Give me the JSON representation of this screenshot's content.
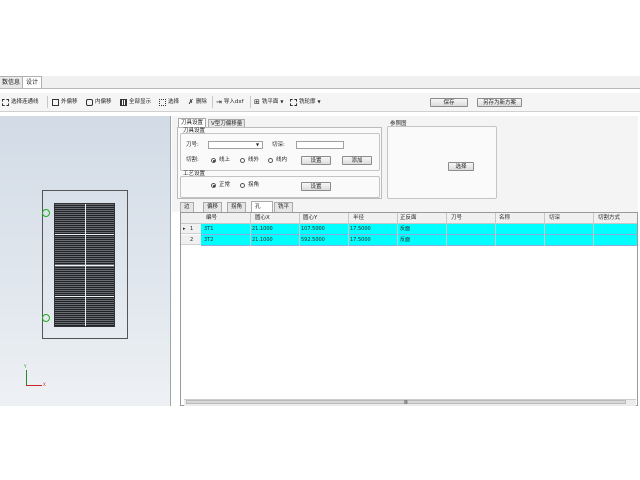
{
  "tabs": [
    {
      "label": "数信息"
    },
    {
      "label": "设计"
    }
  ],
  "toolbar": {
    "select_chain": "选择连通线",
    "outer_offset": "外偏移",
    "inner_offset": "内偏移",
    "show_all": "全部显示",
    "select": "选择",
    "delete": "删除",
    "import_dxf": "导入dxf",
    "mill_plane": "铣平面",
    "mill_contour": "铣轮廓",
    "save": "保存",
    "save_as_new": "另存为新方案"
  },
  "tool_panel": {
    "tabs": [
      "刀具设置",
      "V型刀偏移量"
    ],
    "tool_group_title": "刀具设置",
    "tool_no_label": "刀号:",
    "tool_no_value": "",
    "cut_depth_label": "切深:",
    "cut_depth_value": "",
    "cut_label": "切割:",
    "cut_options": [
      "线上",
      "线外",
      "线内"
    ],
    "cut_selected": 0,
    "setup_button": "设置",
    "add_button": "添加",
    "process_group_title": "工艺设置",
    "process_options": [
      "正常",
      "拐角"
    ],
    "process_selected": 0,
    "process_setup_button": "设置"
  },
  "reference": {
    "title": "参照图",
    "select_button": "选择"
  },
  "grid": {
    "tabs": [
      "边",
      "偏移",
      "拐角",
      "孔",
      "铣平"
    ],
    "active_tab": 3,
    "columns": [
      "编号",
      "圆心X",
      "圆心Y",
      "半径",
      "正反面",
      "刀号",
      "名称",
      "切深",
      "切割方式"
    ],
    "rows": [
      {
        "marker": "▸",
        "index": "1",
        "cells": [
          "3T1",
          "21.1000",
          "107.5000",
          "17.5000",
          "反面",
          "",
          "",
          "",
          ""
        ]
      },
      {
        "marker": "",
        "index": "2",
        "cells": [
          "3T2",
          "21.1000",
          "592.5000",
          "17.5000",
          "反面",
          "",
          "",
          "",
          ""
        ]
      }
    ],
    "scroll_glyph": "▥"
  },
  "viewport": {
    "axis_y": "Y",
    "axis_x": "X"
  },
  "colors": {
    "row_highlight": "#00ffff",
    "hole_marker": "#22aa22"
  }
}
